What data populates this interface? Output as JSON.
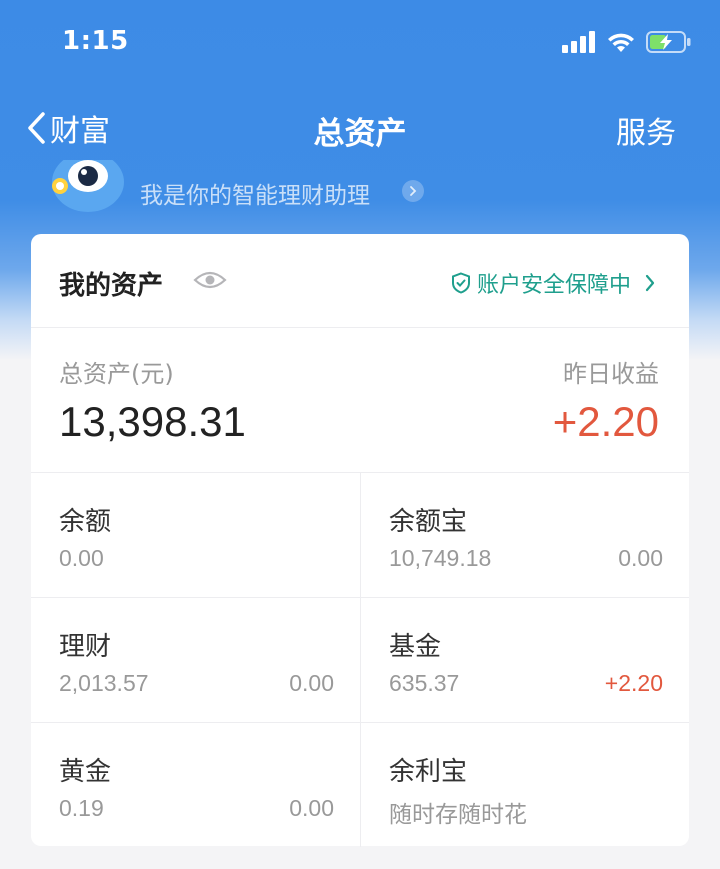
{
  "status": {
    "time": "1:15"
  },
  "nav": {
    "back_label": "财富",
    "title": "总资产",
    "right_label": "服务"
  },
  "assistant": {
    "text": "我是你的智能理财助理"
  },
  "card": {
    "title": "我的资产",
    "security_label": "账户安全保障中",
    "total_label": "总资产(元)",
    "total_value": "13,398.31",
    "yield_label": "昨日收益",
    "yield_value": "+2.20"
  },
  "assets": [
    {
      "name": "余额",
      "amount": "0.00",
      "yield": ""
    },
    {
      "name": "余额宝",
      "amount": "10,749.18",
      "yield": "0.00"
    },
    {
      "name": "理财",
      "amount": "2,013.57",
      "yield": "0.00"
    },
    {
      "name": "基金",
      "amount": "635.37",
      "yield": "+2.20"
    },
    {
      "name": "黄金",
      "amount": "0.19",
      "yield": "0.00"
    },
    {
      "name": "余利宝",
      "amount": "随时存随时花",
      "yield": ""
    }
  ],
  "colors": {
    "brand_blue": "#3d8be6",
    "positive_red": "#e2583e",
    "security_green": "#1f9f8d"
  }
}
